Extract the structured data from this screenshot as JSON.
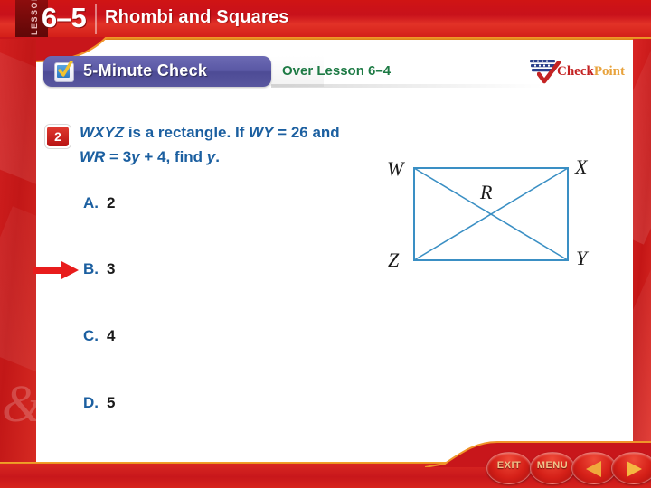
{
  "header": {
    "lesson_word": "LESSON",
    "lesson_number": "6–5",
    "title": "Rhombi and Squares"
  },
  "toolbar": {
    "check_tab_label": "5-Minute Check",
    "check_icon": "checkbox-check-icon",
    "over_lesson_label": "Over Lesson 6–4",
    "logo": {
      "icon": "checkpoint-flag-icon",
      "word1": "Check",
      "word2": "Point"
    }
  },
  "question": {
    "number": "2",
    "line1_part1": "WXYZ",
    "line1_part2": " is a rectangle. If ",
    "line1_part3": "WY",
    "line1_part4": " = 26 and",
    "line2_part1": "WR",
    "line2_part2": " = 3",
    "line2_part3": "y",
    "line2_part4": " + 4, find ",
    "line2_part5": "y",
    "line2_part6": "."
  },
  "choices": [
    {
      "letter": "A.",
      "value": "2",
      "selected": false
    },
    {
      "letter": "B.",
      "value": "3",
      "selected": true
    },
    {
      "letter": "C.",
      "value": "4",
      "selected": false
    },
    {
      "letter": "D.",
      "value": "5",
      "selected": false
    }
  ],
  "pointer": {
    "icon": "red-arrow-icon",
    "points_to": "B."
  },
  "figure": {
    "type": "rectangle-with-diagonals",
    "vertices": [
      "W",
      "X",
      "Y",
      "Z"
    ],
    "center_label": "R",
    "line_color": "#3a8fc4"
  },
  "footer": {
    "buttons": [
      {
        "name": "exit",
        "label": "EXIT",
        "icon": ""
      },
      {
        "name": "menu",
        "label": "MENU",
        "icon": ""
      },
      {
        "name": "back",
        "label": "",
        "icon": "triangle-left-icon"
      },
      {
        "name": "next",
        "label": "",
        "icon": "triangle-right-icon"
      }
    ]
  },
  "colors": {
    "brand_red": "#c8171b",
    "gold_rule": "#f39d2a",
    "tab_purple": "#5a58a4",
    "question_blue": "#1b5fa0",
    "over_lesson_green": "#1d7a44",
    "figure_blue": "#3a8fc4"
  }
}
